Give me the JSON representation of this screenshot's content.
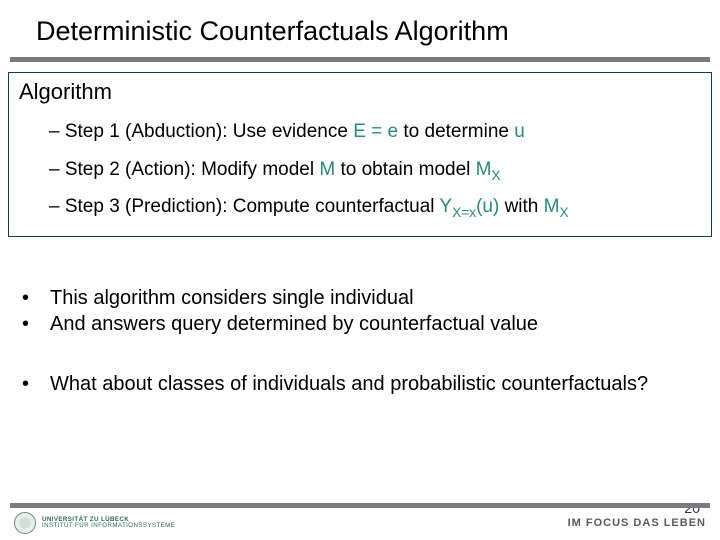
{
  "slide": {
    "title": "Deterministic Counterfactuals Algorithm",
    "box_heading": "Algorithm",
    "steps": [
      {
        "lead": "– Step 1 (Abduction): Use evidence ",
        "teal1": "E = e",
        "mid": " to determine ",
        "teal2": "u"
      },
      {
        "lead": "– Step 2 (Action): Modify model ",
        "teal1": "M",
        "mid": " to obtain model ",
        "teal2_base": "M",
        "teal2_sub": "X"
      },
      {
        "lead": "– Step 3 (Prediction): Compute counterfactual ",
        "teal1_base": "Y",
        "teal1_sub": "X=x",
        "teal1_tail": "(u)",
        "mid": " with ",
        "teal2_base": "M",
        "teal2_sub": "X"
      }
    ],
    "notes": [
      "This algorithm considers single individual",
      "And answers query determined by counterfactual value",
      "What about classes of individuals and probabilistic counterfactuals?"
    ],
    "footer": {
      "uni_line1": "UNIVERSITÄT ZU LÜBECK",
      "uni_line2": "INSTITUT FÜR INFORMATIONSSYSTEME",
      "focus": "IM FOCUS DAS LEBEN",
      "page": "20"
    }
  }
}
